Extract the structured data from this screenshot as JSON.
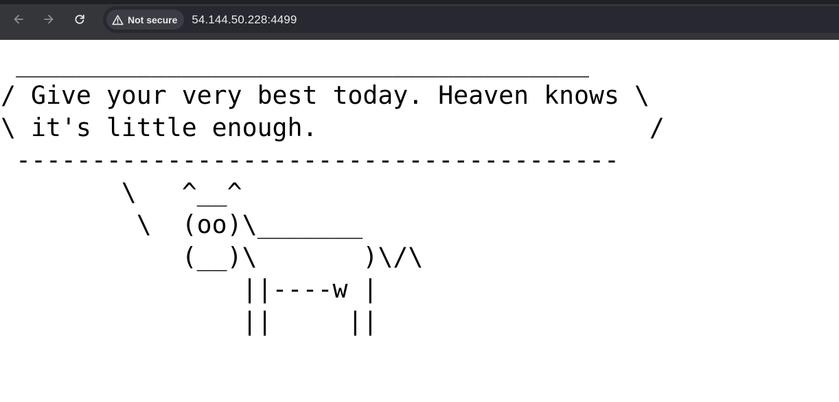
{
  "browser": {
    "nav": {
      "back_icon": "arrow-left-icon",
      "forward_icon": "arrow-right-icon",
      "reload_icon": "reload-icon"
    },
    "security": {
      "icon": "warning-triangle-icon",
      "label": "Not secure"
    },
    "url": "54.144.50.228:4499",
    "colors": {
      "toolbar": "#35363a",
      "omnibox": "#282830",
      "chip": "#3c3c44",
      "text": "#e8eaed",
      "disabled_icon": "#8e8e93"
    }
  },
  "page": {
    "cowsay_text": " ______________________________________\n/ Give your very best today. Heaven knows \\\n\\ it's little enough.                      /\n ----------------------------------------\n        \\   ^__^\n         \\  (oo)\\_______\n            (__)\\       )\\/\\\n                ||----w |\n                ||     ||"
  }
}
